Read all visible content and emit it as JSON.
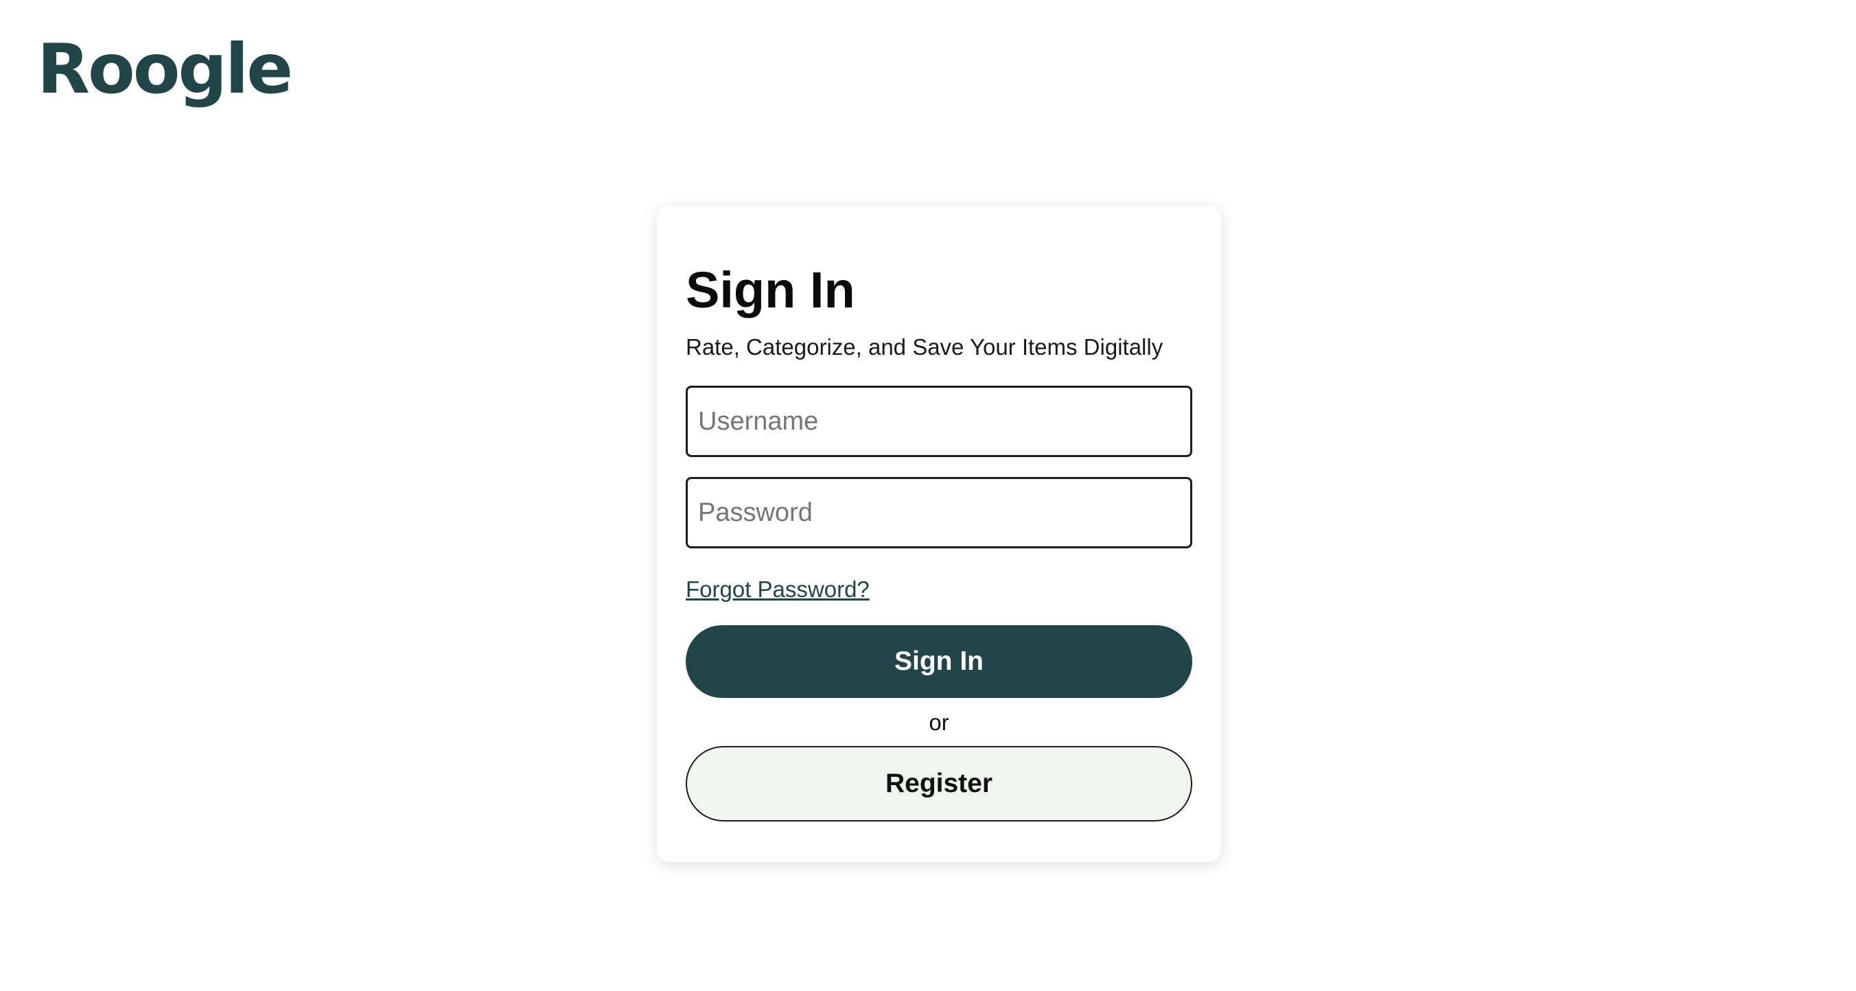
{
  "brand": {
    "name": "Roogle",
    "color": "#214548"
  },
  "signin": {
    "title": "Sign In",
    "subtitle": "Rate, Categorize, and Save Your Items Digitally",
    "username_placeholder": "Username",
    "password_placeholder": "Password",
    "forgot_label": "Forgot Password?",
    "signin_button": "Sign In",
    "or_label": "or",
    "register_button": "Register"
  },
  "colors": {
    "primary": "#214548",
    "register_bg": "#f1f5f0",
    "text": "#111111"
  }
}
